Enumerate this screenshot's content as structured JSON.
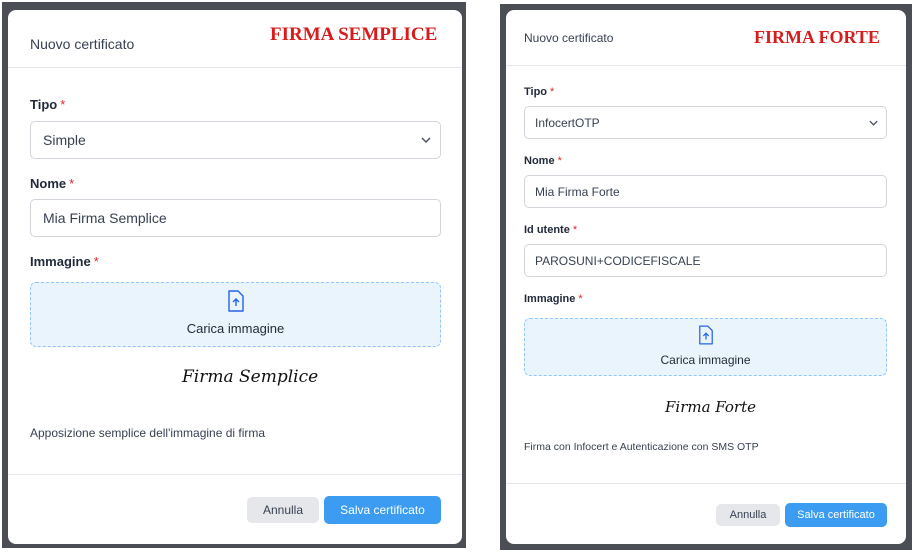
{
  "left": {
    "stamp": "FIRMA SEMPLICE",
    "title": "Nuovo certificato",
    "tipo_label": "Tipo",
    "tipo_value": "Simple",
    "nome_label": "Nome",
    "nome_value": "Mia Firma Semplice",
    "immagine_label": "Immagine",
    "upload_label": "Carica immagine",
    "signature_text": "Firma Semplice",
    "description": "Apposizione semplice dell'immagine di firma",
    "cancel_label": "Annulla",
    "save_label": "Salva certificato"
  },
  "right": {
    "stamp": "FIRMA FORTE",
    "title": "Nuovo certificato",
    "tipo_label": "Tipo",
    "tipo_value": "InfocertOTP",
    "nome_label": "Nome",
    "nome_value": "Mia Firma Forte",
    "id_label": "Id utente",
    "id_value": "PAROSUNI+CODICEFISCALE",
    "immagine_label": "Immagine",
    "upload_label": "Carica immagine",
    "signature_text": "Firma Forte",
    "description": "Firma con Infocert e Autenticazione con SMS OTP",
    "cancel_label": "Annulla",
    "save_label": "Salva certificato"
  },
  "colors": {
    "required": "#dc2626",
    "stamp": "#d81b1b",
    "primary_button": "#3b9cf2",
    "dropzone_bg": "#eaf4fc"
  },
  "icons": {
    "select_chevron": "chevron-down-icon",
    "upload": "file-upload-icon"
  }
}
